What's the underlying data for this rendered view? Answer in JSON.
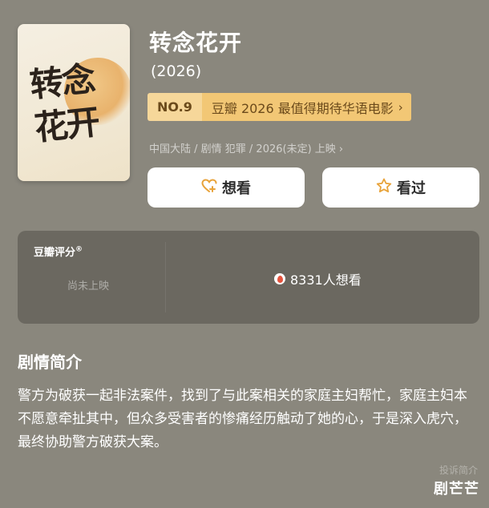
{
  "movie": {
    "title": "转念花开",
    "year": "(2026)",
    "poster_text": "转念花开",
    "rank": {
      "no": "NO.9",
      "text": "豆瓣 2026 最值得期待华语电影",
      "chevron": "›"
    },
    "meta": "中国大陆 / 剧情 犯罪 / 2026(未定) 上映 ›"
  },
  "actions": {
    "want_label": "想看",
    "seen_label": "看过",
    "want_icon": "heart-plus-icon",
    "seen_icon": "star-icon"
  },
  "rating": {
    "label": "豆瓣评分",
    "mark": "®",
    "status": "尚未上映",
    "want_count": "8331人想看"
  },
  "synopsis": {
    "title": "剧情简介",
    "text": "警方为破获一起非法案件，找到了与此案相关的家庭主妇帮忙，家庭主妇本不愿意牵扯其中，但众多受害者的惨痛经历触动了她的心，于是深入虎穴，最终协助警方破获大案。"
  },
  "footer": {
    "report": "投诉简介",
    "watermark": "剧芒芒"
  },
  "colors": {
    "background": "#8a877d",
    "card": "#6b6860",
    "rank_badge": "#f2c775",
    "icon_accent": "#e8a33a"
  }
}
